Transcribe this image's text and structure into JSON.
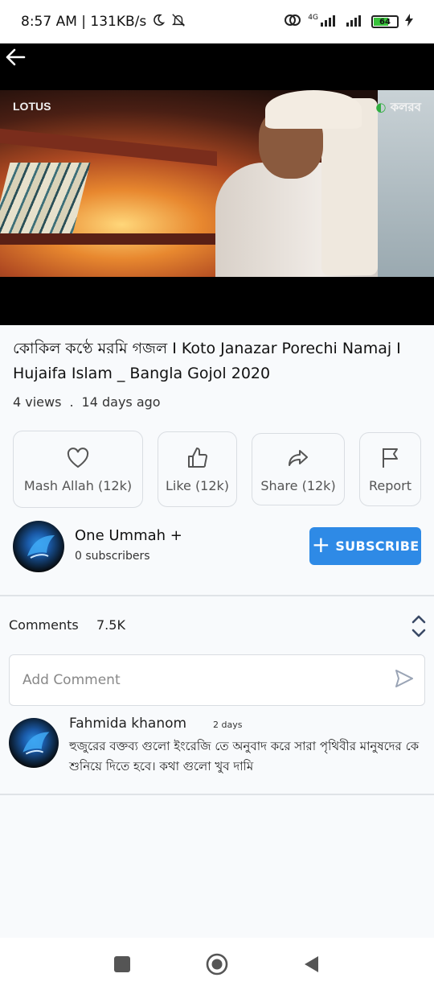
{
  "status_bar": {
    "time_speed": "8:57 AM | 131KB/s",
    "network": "4G",
    "battery": "64"
  },
  "video": {
    "logo_left": "LOTUS",
    "logo_right": "কলরব"
  },
  "title": "কোকিল কণ্ঠে মরমি গজল I Koto Janazar Porechi Namaj I Hujaifa Islam _ Bangla Gojol 2020",
  "meta": {
    "views": "4 views",
    "separator": ".",
    "age": "14 days ago"
  },
  "actions": {
    "mash_allah": "Mash Allah (12k)",
    "like": "Like (12k)",
    "share": "Share (12k)",
    "report": "Report"
  },
  "channel": {
    "name": "One Ummah +",
    "subscribers": "0 subscribers",
    "subscribe_label": "SUBSCRIBE"
  },
  "comments": {
    "label": "Comments",
    "count": "7.5K",
    "add_placeholder": "Add Comment",
    "items": [
      {
        "author": "Fahmida khanom",
        "time": "2 days",
        "text": "হুজুরের বক্তব্য গুলো ইংরেজি তে অনুবাদ করে সারা পৃথিবীর মানুষদের কে শুনিয়ে দিতে হবে। কথা গুলো খুব দামি"
      }
    ]
  },
  "colors": {
    "accent": "#2e8ae6",
    "background": "#f8fafc",
    "border": "#d9dde2"
  }
}
